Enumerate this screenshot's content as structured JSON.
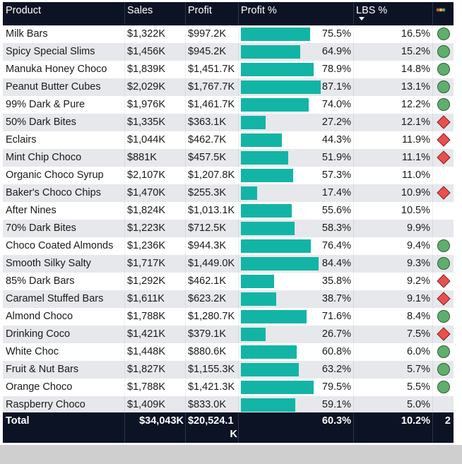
{
  "header": {
    "product": "Product",
    "sales": "Sales",
    "profit": "Profit",
    "profit_pct": "Profit %",
    "lbs_pct": "LBS %"
  },
  "colors": {
    "bar": "#12b5a5",
    "row_even": "#ffffff",
    "row_odd": "#e6e8ec",
    "good": "#5fae6e",
    "bad": "#e8504e",
    "header_bg": "#0b1325"
  },
  "rows": [
    {
      "product": "Milk Bars",
      "sales": "$1,322K",
      "profit": "$997.2K",
      "profit_pct_text": "75.5%",
      "profit_pct": 75.5,
      "lbs": "16.5%",
      "indicator": "good"
    },
    {
      "product": "Spicy Special Slims",
      "sales": "$1,456K",
      "profit": "$945.2K",
      "profit_pct_text": "64.9%",
      "profit_pct": 64.9,
      "lbs": "15.2%",
      "indicator": "good"
    },
    {
      "product": "Manuka Honey Choco",
      "sales": "$1,839K",
      "profit": "$1,451.7K",
      "profit_pct_text": "78.9%",
      "profit_pct": 78.9,
      "lbs": "14.8%",
      "indicator": "good"
    },
    {
      "product": "Peanut Butter Cubes",
      "sales": "$2,029K",
      "profit": "$1,767.7K",
      "profit_pct_text": "87.1%",
      "profit_pct": 87.1,
      "lbs": "13.1%",
      "indicator": "good"
    },
    {
      "product": "99% Dark & Pure",
      "sales": "$1,976K",
      "profit": "$1,461.7K",
      "profit_pct_text": "74.0%",
      "profit_pct": 74.0,
      "lbs": "12.2%",
      "indicator": "good"
    },
    {
      "product": "50% Dark Bites",
      "sales": "$1,335K",
      "profit": "$363.1K",
      "profit_pct_text": "27.2%",
      "profit_pct": 27.2,
      "lbs": "12.1%",
      "indicator": "bad"
    },
    {
      "product": "Eclairs",
      "sales": "$1,044K",
      "profit": "$462.7K",
      "profit_pct_text": "44.3%",
      "profit_pct": 44.3,
      "lbs": "11.9%",
      "indicator": "bad"
    },
    {
      "product": "Mint Chip Choco",
      "sales": "$881K",
      "profit": "$457.5K",
      "profit_pct_text": "51.9%",
      "profit_pct": 51.9,
      "lbs": "11.1%",
      "indicator": "bad"
    },
    {
      "product": "Organic Choco Syrup",
      "sales": "$2,107K",
      "profit": "$1,207.8K",
      "profit_pct_text": "57.3%",
      "profit_pct": 57.3,
      "lbs": "11.0%",
      "indicator": "none"
    },
    {
      "product": "Baker's Choco Chips",
      "sales": "$1,470K",
      "profit": "$255.3K",
      "profit_pct_text": "17.4%",
      "profit_pct": 17.4,
      "lbs": "10.9%",
      "indicator": "bad"
    },
    {
      "product": "After Nines",
      "sales": "$1,824K",
      "profit": "$1,013.1K",
      "profit_pct_text": "55.6%",
      "profit_pct": 55.6,
      "lbs": "10.5%",
      "indicator": "none"
    },
    {
      "product": "70% Dark Bites",
      "sales": "$1,223K",
      "profit": "$712.5K",
      "profit_pct_text": "58.3%",
      "profit_pct": 58.3,
      "lbs": "9.9%",
      "indicator": "none"
    },
    {
      "product": "Choco Coated Almonds",
      "sales": "$1,236K",
      "profit": "$944.3K",
      "profit_pct_text": "76.4%",
      "profit_pct": 76.4,
      "lbs": "9.4%",
      "indicator": "good"
    },
    {
      "product": "Smooth Silky Salty",
      "sales": "$1,717K",
      "profit": "$1,449.0K",
      "profit_pct_text": "84.4%",
      "profit_pct": 84.4,
      "lbs": "9.3%",
      "indicator": "good"
    },
    {
      "product": "85% Dark Bars",
      "sales": "$1,292K",
      "profit": "$462.1K",
      "profit_pct_text": "35.8%",
      "profit_pct": 35.8,
      "lbs": "9.2%",
      "indicator": "bad"
    },
    {
      "product": "Caramel Stuffed Bars",
      "sales": "$1,611K",
      "profit": "$623.2K",
      "profit_pct_text": "38.7%",
      "profit_pct": 38.7,
      "lbs": "9.1%",
      "indicator": "bad"
    },
    {
      "product": "Almond Choco",
      "sales": "$1,788K",
      "profit": "$1,280.7K",
      "profit_pct_text": "71.6%",
      "profit_pct": 71.6,
      "lbs": "8.4%",
      "indicator": "good"
    },
    {
      "product": "Drinking Coco",
      "sales": "$1,421K",
      "profit": "$379.1K",
      "profit_pct_text": "26.7%",
      "profit_pct": 26.7,
      "lbs": "7.5%",
      "indicator": "bad"
    },
    {
      "product": "White Choc",
      "sales": "$1,448K",
      "profit": "$880.6K",
      "profit_pct_text": "60.8%",
      "profit_pct": 60.8,
      "lbs": "6.0%",
      "indicator": "good"
    },
    {
      "product": "Fruit & Nut Bars",
      "sales": "$1,827K",
      "profit": "$1,155.3K",
      "profit_pct_text": "63.2%",
      "profit_pct": 63.2,
      "lbs": "5.7%",
      "indicator": "good"
    },
    {
      "product": "Orange Choco",
      "sales": "$1,788K",
      "profit": "$1,421.3K",
      "profit_pct_text": "79.5%",
      "profit_pct": 79.5,
      "lbs": "5.5%",
      "indicator": "good"
    },
    {
      "product": "Raspberry Choco",
      "sales": "$1,409K",
      "profit": "$833.0K",
      "profit_pct_text": "59.1%",
      "profit_pct": 59.1,
      "lbs": "5.0%",
      "indicator": "none"
    }
  ],
  "total": {
    "label": "Total",
    "sales": "$34,043K",
    "profit_line1": "$20,524.1",
    "profit_line2": "K",
    "profit_pct": "60.3%",
    "lbs": "10.2%",
    "count": "2"
  }
}
